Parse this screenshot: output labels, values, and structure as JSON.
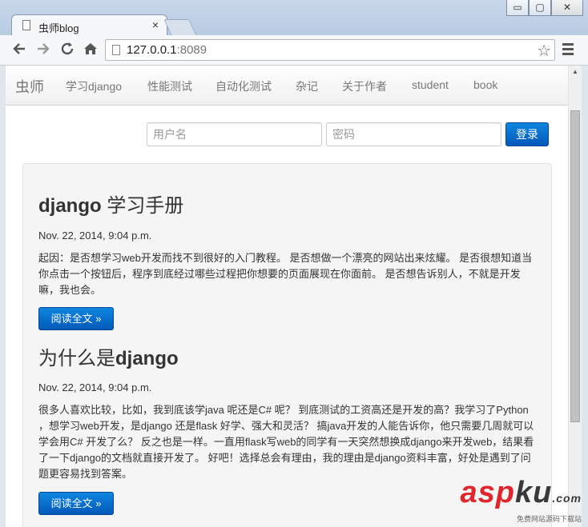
{
  "browser": {
    "tab_title": "虫师blog",
    "tab_close": "×",
    "url_host": "127.0.0.1",
    "url_port": ":8089",
    "win_minimize": "▭",
    "win_maximize": "▢",
    "win_close": "✕",
    "icons": [
      "back-arrow-icon",
      "forward-arrow-icon",
      "reload-icon",
      "home-icon",
      "star-icon",
      "menu-icon"
    ]
  },
  "navbar": {
    "brand": "虫师",
    "items": [
      "学习django",
      "性能测试",
      "自动化测试",
      "杂记",
      "关于作者",
      "student",
      "book"
    ]
  },
  "login": {
    "username_placeholder": "用户名",
    "password_placeholder": "密码",
    "submit_label": "登录"
  },
  "posts": [
    {
      "title_latin": "django",
      "title_cjk": " 学习手册",
      "date": "Nov. 22, 2014, 9:04 p.m.",
      "text": "起因：是否想学习web开发而找不到很好的入门教程。 是否想做一个漂亮的网站出来炫耀。 是否很想知道当你点击一个按钮后，程序到底经过哪些过程把你想要的页面展现在你面前。 是否想告诉别人，不就是开发嘛，我也会。",
      "read_more": "阅读全文 »"
    },
    {
      "title_cjk": "为什么是",
      "title_latin": "django",
      "date": "Nov. 22, 2014, 9:04 p.m.",
      "text": "很多人喜欢比较，比如，我到底该学java 呢还是C# 呢？ 到底测试的工资高还是开发的高？我学习了Python ，想学习web开发，是django 还是flask 好学、强大和灵活？ 搞java开发的人能告诉你，他只需要几周就可以学会用C# 开发了么？ 反之也是一样。一直用flask写web的同学有一天突然想换成django来开发web，结果看了一下django的文档就直接开发了。 好吧！选择总会有理由，我的理由是django资料丰富，好处是遇到了问题更容易找到答案。",
      "read_more": "阅读全文 »"
    }
  ],
  "watermark": {
    "asp": "asp",
    "ku": "ku",
    "dotcom": ".com",
    "sub": "免费网站源码下载站"
  }
}
